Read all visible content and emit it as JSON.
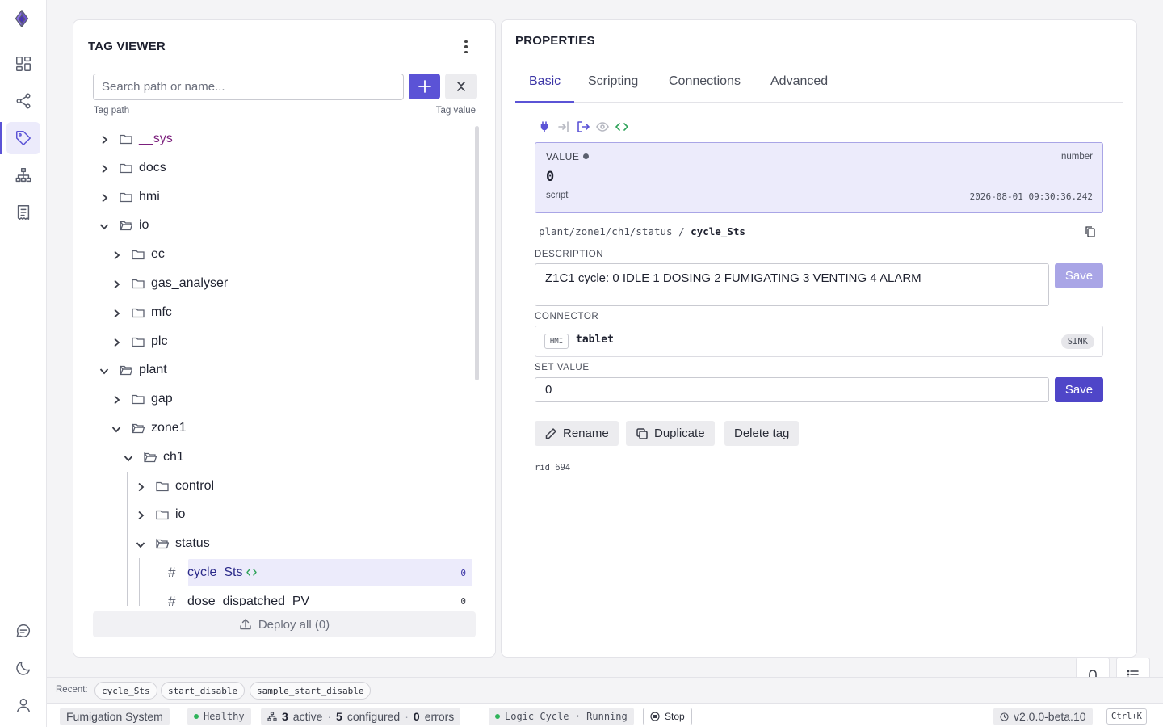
{
  "brand": {
    "accent": "#5b53d6",
    "logo_icon": "gem-icon"
  },
  "nav": [
    {
      "icon": "dashboard-icon",
      "active": false
    },
    {
      "icon": "share-nodes-icon",
      "active": false
    },
    {
      "icon": "tag-icon",
      "active": true
    },
    {
      "icon": "hierarchy-icon",
      "active": false
    },
    {
      "icon": "receipt-icon",
      "active": false
    }
  ],
  "nav_bottom": [
    {
      "icon": "chat-icon"
    },
    {
      "icon": "moon-icon"
    },
    {
      "icon": "user-icon"
    }
  ],
  "tag_viewer": {
    "title": "TAG VIEWER",
    "search_placeholder": "Search path or name...",
    "col_path": "Tag path",
    "col_value": "Tag value",
    "tree": [
      {
        "label": "__sys",
        "depth": 0,
        "kind": "folder",
        "expanded": false
      },
      {
        "label": "docs",
        "depth": 0,
        "kind": "folder",
        "expanded": false
      },
      {
        "label": "hmi",
        "depth": 0,
        "kind": "folder",
        "expanded": false
      },
      {
        "label": "io",
        "depth": 0,
        "kind": "folder",
        "expanded": true
      },
      {
        "label": "ec",
        "depth": 1,
        "kind": "folder",
        "expanded": false
      },
      {
        "label": "gas_analyser",
        "depth": 1,
        "kind": "folder",
        "expanded": false
      },
      {
        "label": "mfc",
        "depth": 1,
        "kind": "folder",
        "expanded": false
      },
      {
        "label": "plc",
        "depth": 1,
        "kind": "folder",
        "expanded": false
      },
      {
        "label": "plant",
        "depth": 0,
        "kind": "folder",
        "expanded": true
      },
      {
        "label": "gap",
        "depth": 1,
        "kind": "folder",
        "expanded": false
      },
      {
        "label": "zone1",
        "depth": 1,
        "kind": "folder",
        "expanded": true
      },
      {
        "label": "ch1",
        "depth": 2,
        "kind": "folder",
        "expanded": true
      },
      {
        "label": "control",
        "depth": 3,
        "kind": "folder",
        "expanded": false
      },
      {
        "label": "io",
        "depth": 3,
        "kind": "folder",
        "expanded": false
      },
      {
        "label": "status",
        "depth": 3,
        "kind": "folder",
        "expanded": true
      },
      {
        "label": "cycle_Sts",
        "depth": 4,
        "kind": "tag",
        "value": "0",
        "selected": true,
        "scripted": true
      },
      {
        "label": "dose_dispatched_PV",
        "depth": 4,
        "kind": "tag",
        "value": "0",
        "selected": false
      }
    ],
    "deploy_label": "Deploy all (0)"
  },
  "properties": {
    "title": "PROPERTIES",
    "tabs": [
      "Basic",
      "Scripting",
      "Connections",
      "Advanced"
    ],
    "active_tab": "Basic",
    "value_label": "VALUE",
    "value_type": "number",
    "value": "0",
    "value_source": "script",
    "value_timestamp": "2026-08-01 09:30:36.242",
    "path_prefix": "plant/zone1/ch1/status",
    "path_sep": "/",
    "tag_name": "cycle_Sts",
    "description_label": "DESCRIPTION",
    "description": "Z1C1 cycle: 0 IDLE 1 DOSING 2 FUMIGATING 3 VENTING 4 ALARM",
    "save_label": "Save",
    "connector_label": "CONNECTOR",
    "connector_badge": "HMI",
    "connector_name": "tablet",
    "connector_mode": "SINK",
    "set_value_label": "SET VALUE",
    "set_value": "0",
    "rename_label": "Rename",
    "duplicate_label": "Duplicate",
    "delete_label": "Delete tag",
    "rid": "rid 694"
  },
  "recent": {
    "label": "Recent:",
    "items": [
      "cycle_Sts",
      "start_disable",
      "sample_start_disable"
    ]
  },
  "status": {
    "project": "Fumigation System",
    "health": "Healthy",
    "active_count": "3",
    "active_label": "active",
    "configured_count": "5",
    "configured_label": "configured",
    "error_count": "0",
    "error_label": "errors",
    "dot": "·",
    "logic": "Logic Cycle · Running",
    "stop_label": "Stop",
    "version": "v2.0.0-beta.10",
    "shortcut": "Ctrl+K"
  }
}
